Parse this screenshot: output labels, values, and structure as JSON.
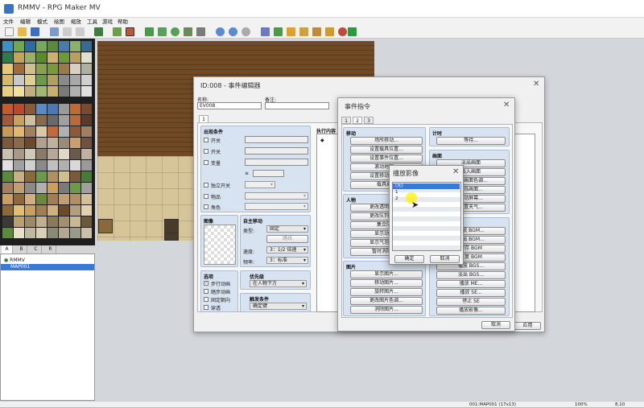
{
  "app": {
    "title": "RMMV - RPG Maker MV"
  },
  "menu": [
    "文件",
    "编辑",
    "模式",
    "绘图",
    "缩放",
    "工具",
    "游戏",
    "帮助"
  ],
  "tile_tabs": [
    "A",
    "B",
    "C",
    "R"
  ],
  "map_tree": {
    "root": "RMMV",
    "selected": "MAP001"
  },
  "status": {
    "map": "001:MAP001 (17x13)",
    "zoom": "100%",
    "coord": "8,10"
  },
  "editor": {
    "title": "ID:008 - 事件编辑器",
    "name_label": "名称:",
    "name_value": "EV008",
    "note_label": "备注:",
    "page_tab": "1",
    "conditions": {
      "title": "出现条件",
      "switch1": "开关",
      "switch2": "开关",
      "variable": "变量",
      "gte": "≥",
      "self_switch": "独立开关",
      "item": "物品",
      "actor": "角色"
    },
    "image": {
      "title": "图像"
    },
    "movement": {
      "title": "自主移动",
      "type_label": "类型:",
      "type_value": "固定",
      "route_button": "路线",
      "speed_label": "速度:",
      "speed_value": "3：1/2 倍速",
      "freq_label": "频率:",
      "freq_value": "3：标准"
    },
    "options": {
      "title": "选项",
      "walk": "步行动画",
      "step": "踏步动画",
      "fixdir": "固定朝向",
      "through": "穿透"
    },
    "priority": {
      "title": "优先级",
      "value": "在人物下方"
    },
    "trigger": {
      "title": "触发条件",
      "value": "确定键"
    },
    "contents_title": "执行内容",
    "contents_marker": "◆",
    "cancel": "取消",
    "apply": "应用"
  },
  "commands": {
    "title": "事件指令",
    "tabs": [
      "1",
      "2",
      "3"
    ],
    "movement": {
      "title": "移动",
      "items": [
        "场所移动...",
        "设置载具位置...",
        "设置事件位置...",
        "滚动地图...",
        "设置移动路线...",
        "载具乘降"
      ]
    },
    "timing": {
      "title": "计时",
      "items": [
        "等待..."
      ]
    },
    "screen": {
      "title": "画面",
      "items": [
        "淡出画面",
        "淡入画面",
        "更改画面色调...",
        "闪烁画面...",
        "震动屏幕...",
        "设置天气..."
      ]
    },
    "character": {
      "title": "人物",
      "items": [
        "更改透明状态...",
        "更改队列行进...",
        "集合队列",
        "显示动画...",
        "显示气泡图标...",
        "暂时消除事件"
      ]
    },
    "audio": {
      "items": [
        "播放 BGM...",
        "淡出 BGM...",
        "保存 BGM",
        "恢复 BGM",
        "播放 BGS...",
        "淡出 BGS...",
        "播放 ME...",
        "播放 SE...",
        "停止 SE",
        "播放影像..."
      ]
    },
    "picture": {
      "title": "图片",
      "items": [
        "显示图片...",
        "移动图片...",
        "旋转图片...",
        "更改图片色调...",
        "消除图片..."
      ]
    },
    "cancel": "取消"
  },
  "video": {
    "title": "播放影像",
    "items": [
      "(无)",
      "1",
      "2"
    ],
    "selected": "(无)",
    "ok": "确定",
    "cancel": "取消"
  },
  "colors": {
    "selection": "#3a79d8",
    "panel": "#d7e3f0",
    "highlight": "#ffff00"
  }
}
